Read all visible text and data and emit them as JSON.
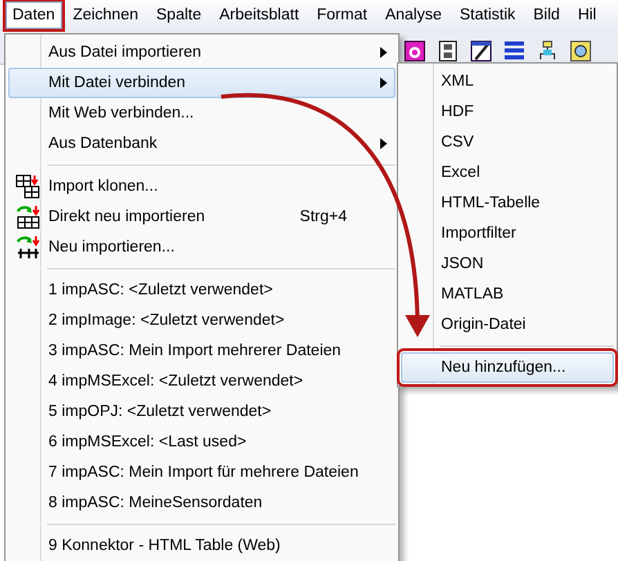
{
  "menubar": [
    {
      "label": "Daten",
      "selected": true,
      "annotated": true
    },
    {
      "label": "Zeichnen",
      "selected": false,
      "annotated": false
    },
    {
      "label": "Spalte",
      "selected": false,
      "annotated": false
    },
    {
      "label": "Arbeitsblatt",
      "selected": false,
      "annotated": false
    },
    {
      "label": "Format",
      "selected": false,
      "annotated": false
    },
    {
      "label": "Analyse",
      "selected": false,
      "annotated": false
    },
    {
      "label": "Statistik",
      "selected": false,
      "annotated": false
    },
    {
      "label": "Bild",
      "selected": false,
      "annotated": false
    },
    {
      "label": "Hil",
      "selected": false,
      "annotated": false
    }
  ],
  "menu": {
    "items": [
      {
        "kind": "item",
        "label": "Aus Datei importieren",
        "has_submenu": true,
        "selected": false
      },
      {
        "kind": "item",
        "label": "Mit Datei verbinden",
        "has_submenu": true,
        "selected": true
      },
      {
        "kind": "item",
        "label": "Mit Web verbinden...",
        "has_submenu": false,
        "selected": false
      },
      {
        "kind": "item",
        "label": "Aus Datenbank",
        "has_submenu": true,
        "selected": false
      },
      {
        "kind": "separator"
      },
      {
        "kind": "tool",
        "label": "Import klonen...",
        "has_submenu": false,
        "selected": false
      },
      {
        "kind": "tool",
        "label": "Direkt neu importieren",
        "shortcut": "Strg+4",
        "has_submenu": false,
        "selected": false
      },
      {
        "kind": "tool",
        "label": "Neu importieren...",
        "has_submenu": false,
        "selected": false
      },
      {
        "kind": "separator"
      },
      {
        "kind": "item",
        "label": "1 impASC: <Zuletzt verwendet>",
        "has_submenu": false,
        "selected": false
      },
      {
        "kind": "item",
        "label": "2 impImage: <Zuletzt verwendet>",
        "has_submenu": false,
        "selected": false
      },
      {
        "kind": "item",
        "label": "3 impASC: Mein Import mehrerer Dateien",
        "has_submenu": false,
        "selected": false
      },
      {
        "kind": "item",
        "label": "4 impMSExcel: <Zuletzt verwendet>",
        "has_submenu": false,
        "selected": false
      },
      {
        "kind": "item",
        "label": "5 impOPJ: <Zuletzt verwendet>",
        "has_submenu": false,
        "selected": false
      },
      {
        "kind": "item",
        "label": "6 impMSExcel: <Last used>",
        "has_submenu": false,
        "selected": false
      },
      {
        "kind": "item",
        "label": "7 impASC: Mein Import für mehrere Dateien",
        "has_submenu": false,
        "selected": false
      },
      {
        "kind": "item",
        "label": "8 impASC: MeineSensordaten",
        "has_submenu": false,
        "selected": false
      },
      {
        "kind": "separator"
      },
      {
        "kind": "item",
        "label": "9 Konnektor - HTML Table (Web)",
        "has_submenu": false,
        "selected": false
      }
    ]
  },
  "submenu": {
    "items": [
      {
        "kind": "item",
        "label": "XML",
        "selected": false,
        "annotated": false
      },
      {
        "kind": "item",
        "label": "HDF",
        "selected": false,
        "annotated": false
      },
      {
        "kind": "item",
        "label": "CSV",
        "selected": false,
        "annotated": false
      },
      {
        "kind": "item",
        "label": "Excel",
        "selected": false,
        "annotated": false
      },
      {
        "kind": "item",
        "label": "HTML-Tabelle",
        "selected": false,
        "annotated": false
      },
      {
        "kind": "item",
        "label": "Importfilter",
        "selected": false,
        "annotated": false
      },
      {
        "kind": "item",
        "label": "JSON",
        "selected": false,
        "annotated": false
      },
      {
        "kind": "item",
        "label": "MATLAB",
        "selected": false,
        "annotated": false
      },
      {
        "kind": "item",
        "label": "Origin-Datei",
        "selected": false,
        "annotated": false
      },
      {
        "kind": "separator"
      },
      {
        "kind": "item",
        "label": "Neu hinzufügen...",
        "selected": true,
        "annotated": true
      }
    ]
  }
}
